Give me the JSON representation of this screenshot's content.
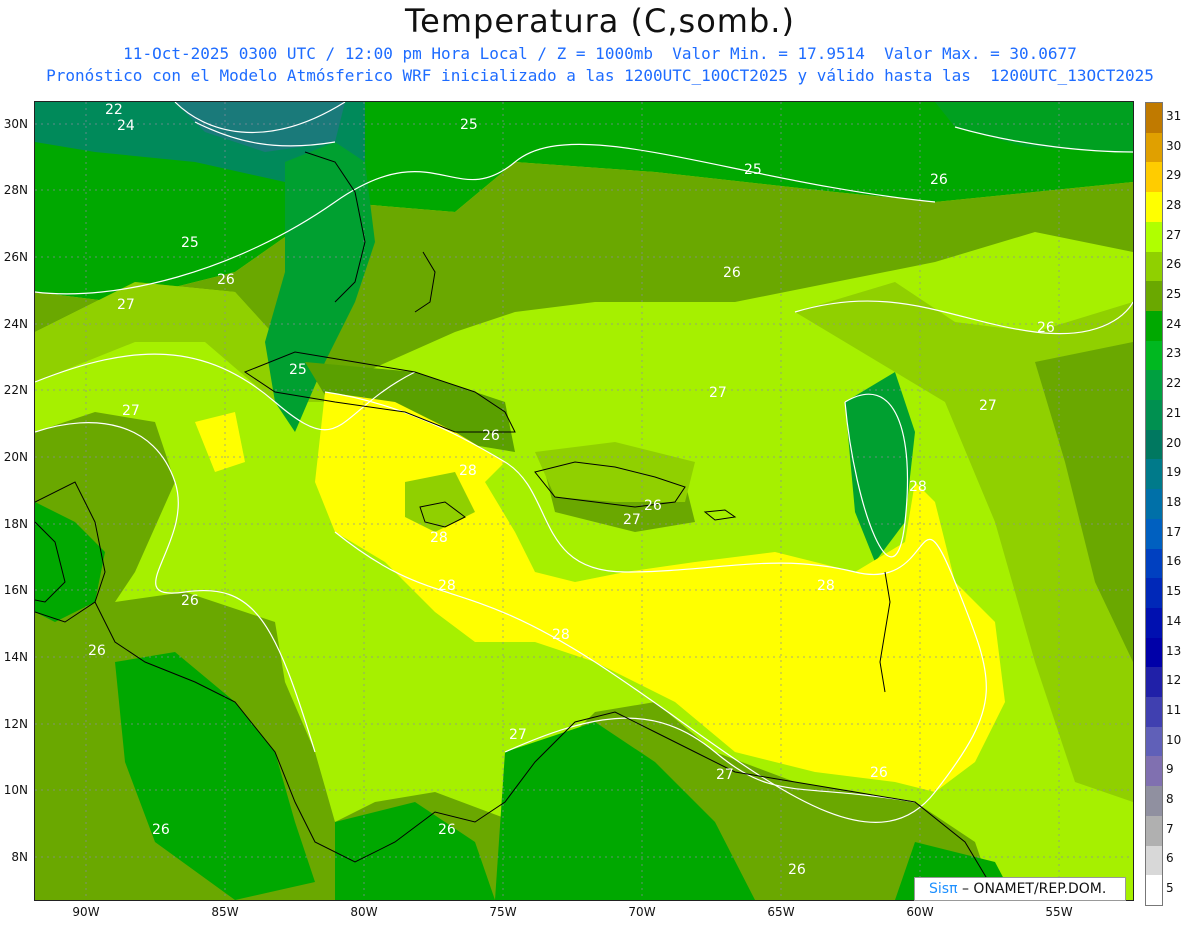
{
  "header": {
    "title": "Temperatura (C,somb.)",
    "subtitle1": "11-Oct-2025 0300 UTC / 12:00 pm Hora Local / Z = 1000mb  Valor Min. = 17.9514  Valor Max. = 30.0677",
    "subtitle2": "Pronóstico con el Modelo Atmósferico WRF inicializado a las 1200UTC_10OCT2025 y válido hasta las  1200UTC_13OCT2025"
  },
  "map": {
    "lat_labels": [
      "30N",
      "28N",
      "26N",
      "24N",
      "22N",
      "20N",
      "18N",
      "16N",
      "14N",
      "12N",
      "10N",
      "8N"
    ],
    "lon_labels": [
      "90W",
      "85W",
      "80W",
      "75W",
      "70W",
      "65W",
      "60W",
      "55W"
    ],
    "contour_labels": [
      "22",
      "24",
      "25",
      "25",
      "26",
      "26",
      "27",
      "25",
      "26",
      "26",
      "27",
      "27",
      "25",
      "27",
      "26",
      "28",
      "28",
      "28",
      "26",
      "27",
      "28",
      "26",
      "26",
      "28",
      "28",
      "27",
      "27",
      "26",
      "26",
      "26",
      "26"
    ]
  },
  "colorbar": {
    "labels": [
      "31",
      "30",
      "29",
      "28",
      "27",
      "26",
      "25",
      "24",
      "23",
      "22",
      "21",
      "20",
      "19",
      "18",
      "17",
      "16",
      "15",
      "14",
      "13",
      "12",
      "11",
      "10",
      "9",
      "8",
      "7",
      "6",
      "5"
    ],
    "colors": [
      "#c07a00",
      "#e0a000",
      "#ffcc00",
      "#ffff00",
      "#b0ff00",
      "#90d000",
      "#6aa800",
      "#00a800",
      "#00b820",
      "#00a040",
      "#009050",
      "#007860",
      "#007a8a",
      "#0070a8",
      "#0060c0",
      "#0040c0",
      "#0028b8",
      "#0010b0",
      "#0000a8",
      "#2020a8",
      "#4040b0",
      "#6060b8",
      "#8070b0",
      "#9090a0",
      "#b0b0b0",
      "#d8d8d8",
      "#ffffff"
    ]
  },
  "credit": {
    "logo": "Sis",
    "pi": "π",
    "text": "–  ONAMET/REP.DOM."
  }
}
